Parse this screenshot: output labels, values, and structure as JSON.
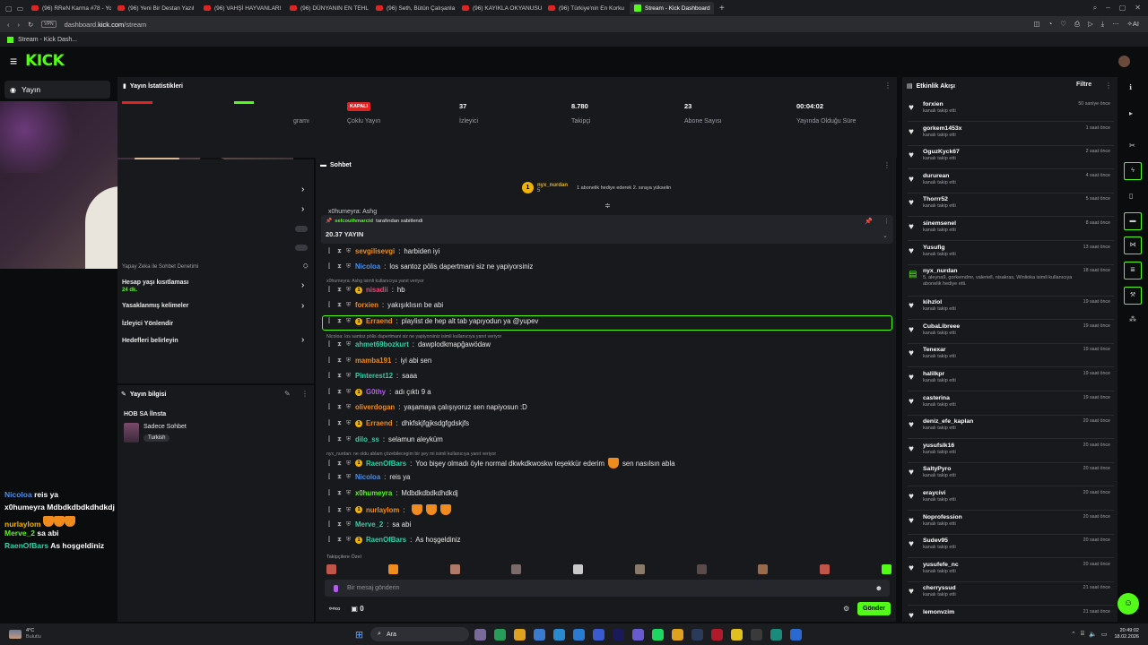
{
  "browser": {
    "tabs": [
      {
        "label": "(96) RReN Karma #78 - Yo"
      },
      {
        "label": "(96) Yeni Bir Destan Yazıl"
      },
      {
        "label": "(96) VAHŞİ HAYVANLARI"
      },
      {
        "label": "(96) DÜNYANIN EN TEHL"
      },
      {
        "label": "(96) Seth, Bütün Çalışanla"
      },
      {
        "label": "(96) KAYIKLA OKYANUSU"
      },
      {
        "label": "(96) Türkiye'nin En Korku"
      },
      {
        "label": "Stream - Kick Dashboard",
        "active": true
      }
    ],
    "vpn": "VPN",
    "url_prefix": "dashboard.",
    "url_domain": "kick.com",
    "url_path": "/stream",
    "bookmark": "Stream - Kick Dash..."
  },
  "kick": {
    "logo": "KICK"
  },
  "sidebar": {
    "nav_label": "Yayın",
    "items": [
      {
        "label": "Hesap yaşı kısıtlaması",
        "sub": "24 dk."
      },
      {
        "label": "Yasaklanmış kelimeler"
      },
      {
        "label": "İzleyici Yönlendir"
      },
      {
        "label": "Hedefleri belirleyin"
      }
    ],
    "partial_label": "Yapay Zeka ile Sohbet Denetimi",
    "partial_label2": "gramı"
  },
  "stats": {
    "title": "Yayın İstatistikleri",
    "items": [
      {
        "value": "KAPALI",
        "label": "Çoklu Yayın",
        "badge": true
      },
      {
        "value": "37",
        "label": "İzleyici"
      },
      {
        "value": "8.780",
        "label": "Takipçi"
      },
      {
        "value": "23",
        "label": "Abone Sayısı"
      },
      {
        "value": "00:04:02",
        "label": "Yayında Olduğu Süre"
      }
    ]
  },
  "stream_info": {
    "title": "Yayın bilgisi",
    "stream_title": "HOB SA İlnsta",
    "category": "Sadece Sohbet",
    "tag": "Turkish"
  },
  "chat": {
    "title": "Sohbet",
    "gift_user": "nyx_nurdan",
    "gift_count": "5",
    "gift_text": "1 abonelik hediye ederek 2. sıraya yükselin",
    "pinned_by": "selcouthmarcid",
    "pinned_suffix": "tarafından sabitlendi",
    "pinned_msg": "20.37 YAYIN",
    "cut_msg": "x0humeyra: Ashg",
    "messages": [
      {
        "user": "sevgilisevgi",
        "text": "harbiden iyi",
        "color": "#f08b1d",
        "sub": false
      },
      {
        "user": "Nicoloa",
        "text": "los santoz pölis dapertmani siz ne yapiyorsiniz",
        "color": "#4b8fe6",
        "sub": false
      },
      {
        "reply": "x0humeyra: Ashg isimli kullanıcıya yanıt veriyor"
      },
      {
        "user": "nisadii",
        "text": "hb",
        "color": "#e8457a",
        "sub": true
      },
      {
        "user": "forxien",
        "text": "yakışıklısın be abi",
        "color": "#f08b1d",
        "sub": false
      },
      {
        "user": "Erraend",
        "text": "playlist de hep alt tab yapıyodun ya @yupev",
        "color": "#f08b1d",
        "sub": true,
        "highlight": true
      },
      {
        "reply": "Nicoloa: los santoz pölis dapertmani siz ne yapiyorsiniz isimli kullanıcıya yanıt veriyor"
      },
      {
        "user": "ahmet69bozkurt",
        "text": "dawplodkmapğawödaw",
        "color": "#2fd0a8",
        "sub": false
      },
      {
        "user": "mamba191",
        "text": "iyi abi sen",
        "color": "#f08b1d",
        "sub": false
      },
      {
        "user": "Pinterest12",
        "text": "saaa",
        "color": "#2fd0a8",
        "sub": false
      },
      {
        "user": "G0thy",
        "text": "adı çıktı 9 a",
        "color": "#b45cf0",
        "sub": true
      },
      {
        "user": "oliverdogan",
        "text": "yaşamaya çalışıyoruz sen napiyosun :D",
        "color": "#f08b1d",
        "sub": false
      },
      {
        "user": "Erraend",
        "text": "dhkfskjfgjksdgfgdskjfs",
        "color": "#f08b1d",
        "sub": true
      },
      {
        "user": "dilo_ss",
        "text": "selamun aleyküm",
        "color": "#2fd0a8",
        "sub": false
      },
      {
        "reply": "nyx_nurdan: ne oldu ablam çözebilecegim bir şey mi isimli kullanıcıya yanıt veriyor"
      },
      {
        "user": "RaenOfBars",
        "text": "Yoo bişey olmadı öyle normal dkwkdkwoskw teşekkür ederim",
        "text2": "sen nasılsın abla",
        "color": "#2fd0a8",
        "sub": true,
        "emote": true
      },
      {
        "user": "Nicoloa",
        "text": "reis ya",
        "color": "#4b8fe6",
        "sub": false
      },
      {
        "user": "x0humeyra",
        "text": "Mdbdkdbdkdhdkdj",
        "color": "#53fc18",
        "sub": false
      },
      {
        "user": "nurlaylom",
        "text": "",
        "color": "#f08b1d",
        "sub": true,
        "emotes3": true
      },
      {
        "user": "Merve_2",
        "text": "sa abi",
        "color": "#2fd0a8",
        "sub": false
      },
      {
        "user": "RaenOfBars",
        "text": "As hoşgeldiniz",
        "color": "#2fd0a8",
        "sub": true
      }
    ],
    "emote_label": "Takipçilere Özel",
    "input_placeholder": "Bir mesaj gönderin",
    "points": "0",
    "send_label": "Gönder"
  },
  "activity": {
    "title": "Etkinlik Akışı",
    "filter": "Filtre",
    "items": [
      {
        "name": "forxien",
        "desc": "kanalı takip etti",
        "time": "50 saniye önce"
      },
      {
        "name": "gorkem1453x",
        "desc": "kanalı takip etti",
        "time": "1 saat önce"
      },
      {
        "name": "OguzKyck67",
        "desc": "kanalı takip etti",
        "time": "2 saat önce"
      },
      {
        "name": "dururean",
        "desc": "kanalı takip etti",
        "time": "4 saat önce"
      },
      {
        "name": "Thorrr52",
        "desc": "kanalı takip etti",
        "time": "5 saat önce"
      },
      {
        "name": "sinemsenel",
        "desc": "kanalı takip etti",
        "time": "8 saat önce"
      },
      {
        "name": "Yusufig",
        "desc": "kanalı takip etti",
        "time": "13 saat önce"
      },
      {
        "name": "nyx_nurdan",
        "desc": "abonelik hediye etti.",
        "gift": "5, aleyna9, gorkemdmr, valeriell, nisakras, Winlioka isimli kullanıcıya",
        "time": "18 saat önce"
      },
      {
        "name": "kihzlol",
        "desc": "kanalı takip etti",
        "time": "19 saat önce"
      },
      {
        "name": "CubaLibreee",
        "desc": "kanalı takip etti",
        "time": "19 saat önce"
      },
      {
        "name": "Tenexar",
        "desc": "kanalı takip etti",
        "time": "19 saat önce"
      },
      {
        "name": "halilkpr",
        "desc": "kanalı takip etti",
        "time": "19 saat önce"
      },
      {
        "name": "casterina",
        "desc": "kanalı takip etti",
        "time": "19 saat önce"
      },
      {
        "name": "deniz_efe_kaplan",
        "desc": "kanalı takip etti",
        "time": "20 saat önce"
      },
      {
        "name": "yusufslk16",
        "desc": "kanalı takip etti",
        "time": "20 saat önce"
      },
      {
        "name": "SaltyPyro",
        "desc": "kanalı takip etti",
        "time": "20 saat önce"
      },
      {
        "name": "eraycivi",
        "desc": "kanalı takip etti",
        "time": "20 saat önce"
      },
      {
        "name": "Noprofession",
        "desc": "kanalı takip etti",
        "time": "20 saat önce"
      },
      {
        "name": "Sudev95",
        "desc": "kanalı takip etti",
        "time": "20 saat önce"
      },
      {
        "name": "yusufefe_nc",
        "desc": "kanalı takip etti",
        "time": "20 saat önce"
      },
      {
        "name": "cherryssud",
        "desc": "kanalı takip etti",
        "time": "21 saat önce"
      },
      {
        "name": "lemonvzim",
        "desc": "",
        "time": "21 saat önce"
      }
    ]
  },
  "overlay_chat": [
    {
      "user": "Nicoloa",
      "text": "reis ya",
      "color": "#4b8fe6"
    },
    {
      "user": "x0humeyra",
      "text": "Mdbdkdbdkdhdkdj",
      "color": "#ffffff"
    },
    {
      "user": "nurlaylom",
      "text": "",
      "color": "#f2b300",
      "emotes": true
    },
    {
      "user": "Merve_2",
      "text": "sa abi",
      "color": "#53fc18"
    },
    {
      "user": "RaenOfBars",
      "text": "As hoşgeldiniz",
      "color": "#2fd0a8"
    }
  ],
  "taskbar": {
    "weather_temp": "4°C",
    "weather_desc": "Bulutlu",
    "search": "Ara",
    "time": "20:49:02",
    "date": "18.02.2026"
  },
  "colors": {
    "accent": "#53fc18",
    "panel": "#18191c",
    "bg": "#0b0c0e"
  }
}
